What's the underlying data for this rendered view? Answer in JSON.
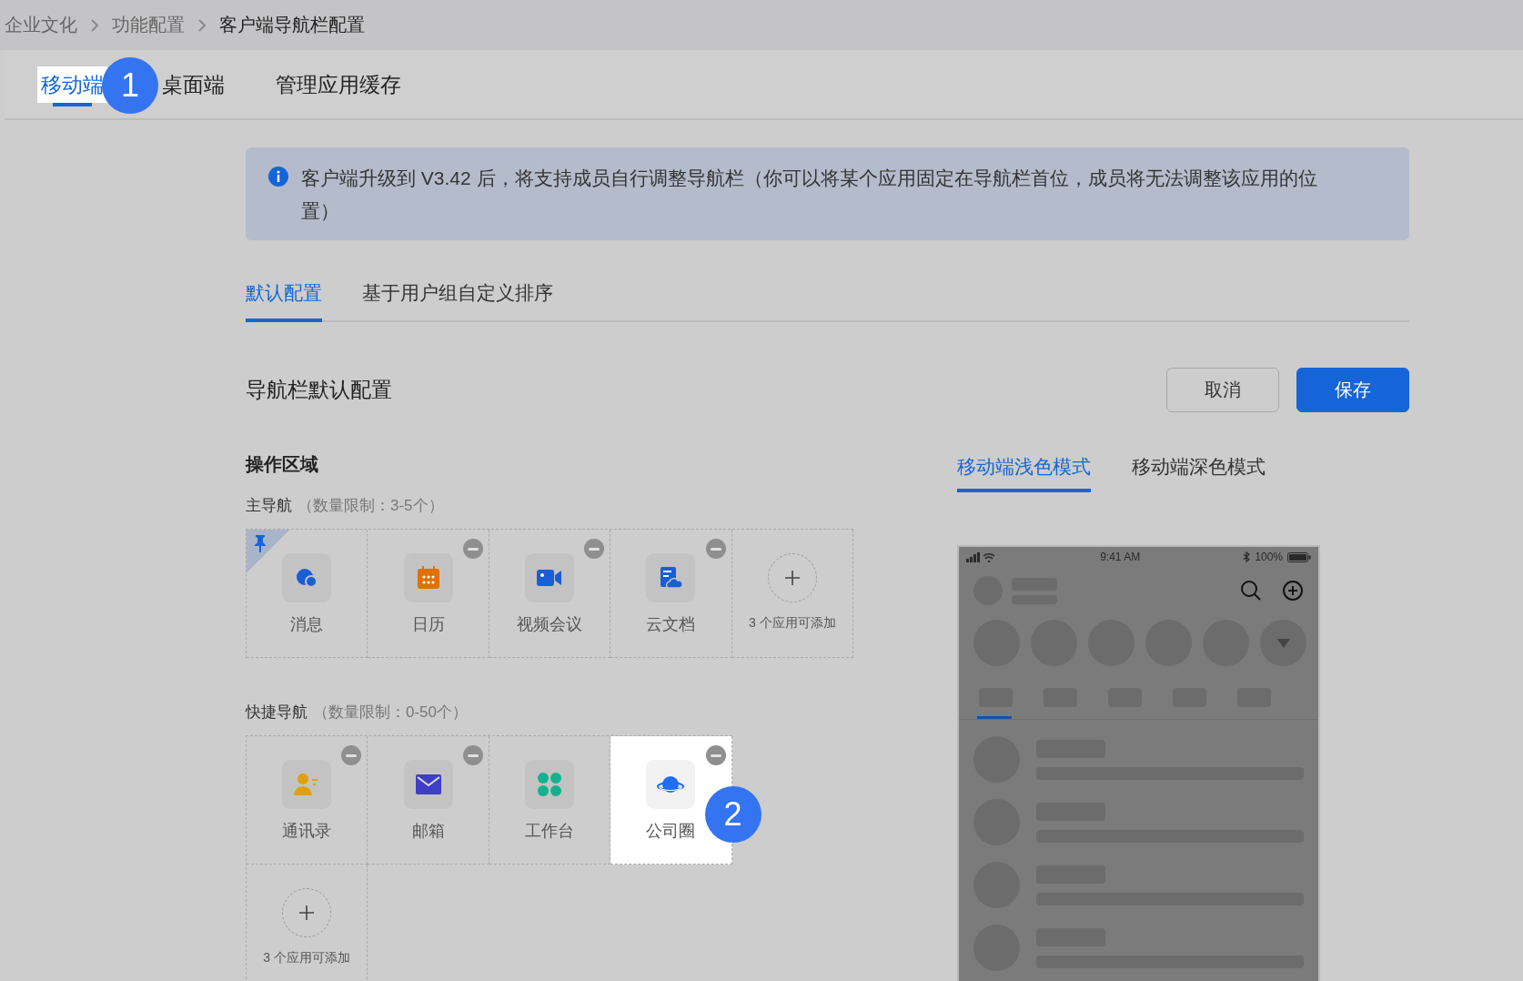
{
  "breadcrumb": [
    "企业文化",
    "功能配置",
    "客户端导航栏配置"
  ],
  "platform_tabs": [
    {
      "label": "移动端",
      "selected": true,
      "highlighted": true,
      "callout": "1"
    },
    {
      "label": "桌面端",
      "selected": false,
      "highlighted": false
    },
    {
      "label": "管理应用缓存",
      "selected": false,
      "highlighted": false
    }
  ],
  "notice": {
    "text": "客户端升级到 V3.42 后，将支持成员自行调整导航栏（你可以将某个应用固定在导航栏首位，成员将无法调整该应用的位置）"
  },
  "config_tabs": [
    {
      "label": "默认配置",
      "selected": true
    },
    {
      "label": "基于用户组自定义排序",
      "selected": false
    }
  ],
  "section_title": "导航栏默认配置",
  "buttons": [
    {
      "label": "取消",
      "kind": "secondary"
    },
    {
      "label": "保存",
      "kind": "primary"
    }
  ],
  "area_title": "操作区域",
  "main_nav": {
    "label": "主导航",
    "limit": "（数量限制：3-5个）",
    "add_hint": "3 个应用可添加",
    "apps": [
      {
        "name": "消息",
        "kind": "chat",
        "pinned": true,
        "removable": false,
        "highlighted": false
      },
      {
        "name": "日历",
        "kind": "calendar",
        "pinned": false,
        "removable": true,
        "highlighted": false
      },
      {
        "name": "视频会议",
        "kind": "video",
        "pinned": false,
        "removable": true,
        "highlighted": false
      },
      {
        "name": "云文档",
        "kind": "doc",
        "pinned": false,
        "removable": true,
        "highlighted": false
      }
    ]
  },
  "quick_nav": {
    "label": "快捷导航",
    "limit": "（数量限制：0-50个）",
    "add_hint": "3 个应用可添加",
    "apps": [
      {
        "name": "通讯录",
        "kind": "contacts",
        "pinned": false,
        "removable": true,
        "highlighted": false
      },
      {
        "name": "邮箱",
        "kind": "mail",
        "pinned": false,
        "removable": true,
        "highlighted": false
      },
      {
        "name": "工作台",
        "kind": "workspace",
        "pinned": false,
        "removable": false,
        "highlighted": false
      },
      {
        "name": "公司圈",
        "kind": "planet",
        "pinned": false,
        "removable": true,
        "highlighted": true,
        "callout": "2"
      }
    ]
  },
  "preview_tabs": [
    {
      "label": "移动端浅色模式",
      "selected": true
    },
    {
      "label": "移动端深色模式",
      "selected": false
    }
  ],
  "phone": {
    "time": "9:41 AM",
    "battery": "100%"
  }
}
